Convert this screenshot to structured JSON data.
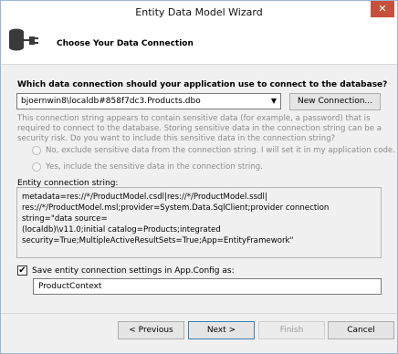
{
  "window": {
    "title": "Entity Data Model Wizard",
    "close_glyph": "✕"
  },
  "header": {
    "title": "Choose Your Data Connection",
    "icon": "database-plug-icon"
  },
  "connection": {
    "question": "Which data connection should your application use to connect to the database?",
    "selected": "bjoernwin8\\localdb#858f7dc3.Products.dbo",
    "new_connection_label": "New Connection..."
  },
  "sensitive": {
    "warning": "This connection string appears to contain sensitive data (for example, a password) that is required to connect to the database. Storing sensitive data in the connection string can be a security risk. Do you want to include this sensitive data in the connection string?",
    "option_exclude": "No, exclude sensitive data from the connection string. I will set it in my application code.",
    "option_include": "Yes, include the sensitive data in the connection string."
  },
  "entity_connection": {
    "label": "Entity connection string:",
    "value": "metadata=res://*/ProductModel.csdl|res://*/ProductModel.ssdl|\nres://*/ProductModel.msl;provider=System.Data.SqlClient;provider connection string=\"data source=\n(localdb)\\v11.0;initial catalog=Products;integrated\nsecurity=True;MultipleActiveResultSets=True;App=EntityFramework\""
  },
  "save_settings": {
    "checked": true,
    "check_glyph": "✔",
    "label": "Save entity connection settings in App.Config as:",
    "value": "ProductContext"
  },
  "buttons": {
    "previous": "< Previous",
    "next": "Next >",
    "finish": "Finish",
    "cancel": "Cancel"
  }
}
